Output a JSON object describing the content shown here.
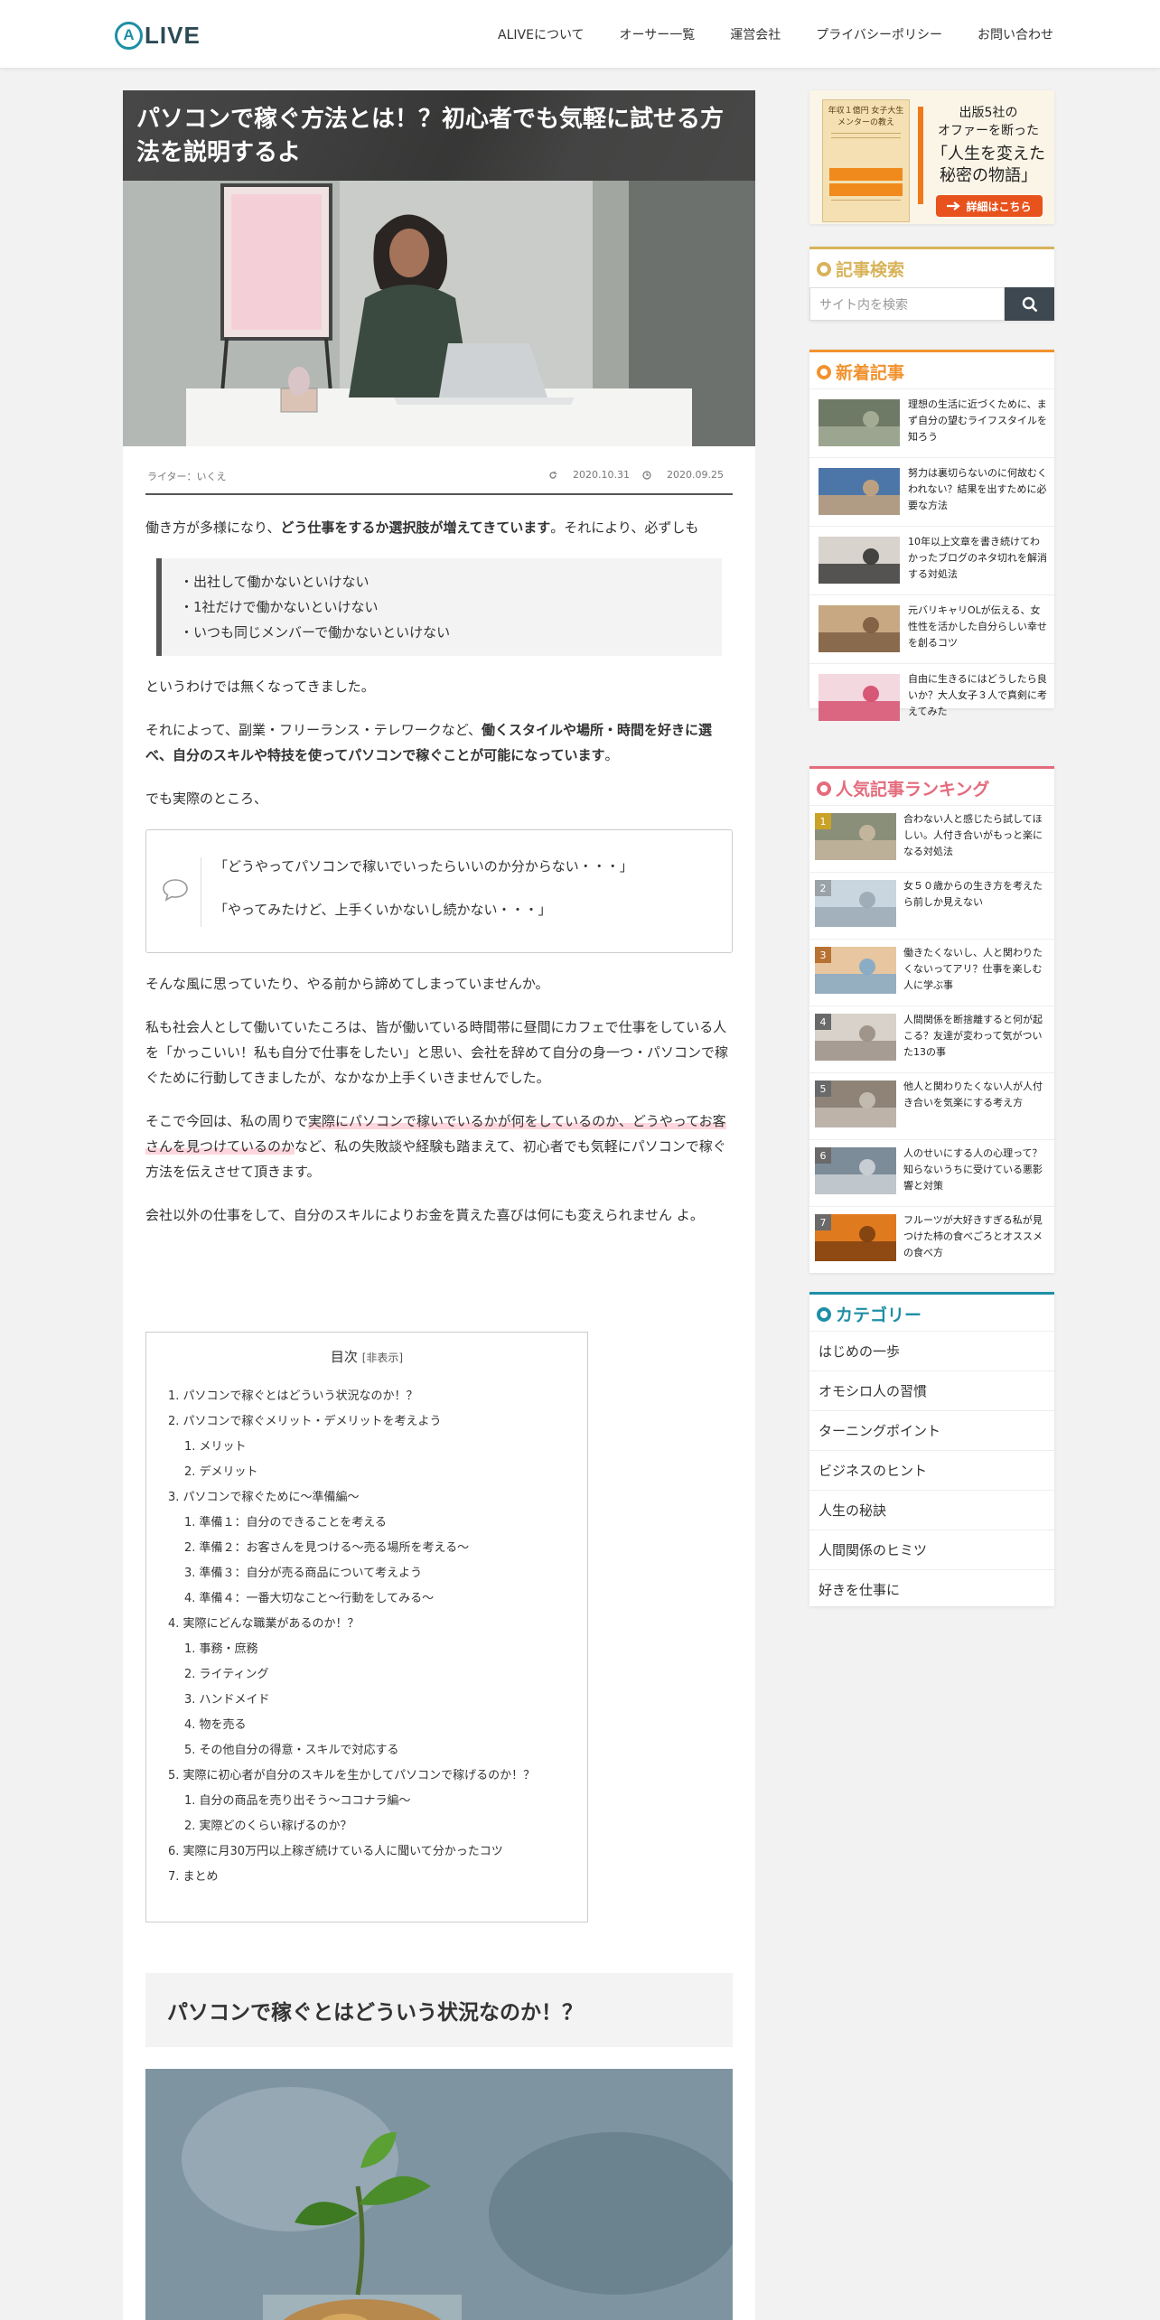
{
  "site": {
    "logo_letter": "A",
    "logo_text": "LIVE",
    "nav": [
      "ALIVEについて",
      "オーサー一覧",
      "運営会社",
      "プライバシーポリシー",
      "お問い合わせ"
    ]
  },
  "article": {
    "title": "パソコンで稼ぐ方法とは！？初心者でも気軽に試せる方法を説明するよ",
    "writer": "ライター：いくえ",
    "updated": "2020.10.31",
    "published": "2020.09.25",
    "p1_a": "働き方が多様になり、",
    "p1_b": "どう仕事をするか選択肢が増えてきています",
    "p1_c": "。それにより、必ずしも",
    "quote_lines": [
      "・出社して働かないといけない",
      "・1社だけで働かないといけない",
      "・いつも同じメンバーで働かないといけない"
    ],
    "p2": "というわけでは無くなってきました。",
    "p3_a": "それによって、副業・フリーランス・テレワークなど、",
    "p3_b": "働くスタイルや場所・時間を好きに選べ、自分のスキルや特技を使ってパソコンで稼ぐことが可能になっています",
    "p3_c": "。",
    "p4": "でも実際のところ、",
    "balloon_lines": [
      "「どうやってパソコンで稼いでいったらいいのか分からない・・・」",
      "「やってみたけど、上手くいかないし続かない・・・」"
    ],
    "p5": "そんな風に思っていたり、やる前から諦めてしまっていませんか。",
    "p6": "私も社会人として働いていたころは、皆が働いている時間帯に昼間にカフェで仕事をしている人を「かっこいい！私も自分で仕事をしたい」と思い、会社を辞めて自分の身一つ・パソコンで稼ぐために行動してきましたが、なかなか上手くいきませんでした。",
    "p7_a": "そこで今回は、私の周りで",
    "p7_b": "実際にパソコンで稼いでいるかが何をしているのか、どうやってお客さんを見つけているのか",
    "p7_c": "など、私の失敗談や経験も踏まえて、初心者でも気軽にパソコンで稼ぐ方法を伝えさせて頂きます。",
    "p8": "会社以外の仕事をして、自分のスキルによりお金を貰えた喜びは何にも変えられません よ。",
    "h2": "パソコンで稼ぐとはどういう状況なのか！？"
  },
  "toc": {
    "title": "目次",
    "toggle": "[非表示]",
    "items": [
      {
        "t": "1. パソコンで稼ぐとはどういう状況なのか！？",
        "sub": false
      },
      {
        "t": "2. パソコンで稼ぐメリット・デメリットを考えよう",
        "sub": false
      },
      {
        "t": "1. メリット",
        "sub": true
      },
      {
        "t": "2. デメリット",
        "sub": true
      },
      {
        "t": "3. パソコンで稼ぐために～準備編～",
        "sub": false
      },
      {
        "t": "1. 準備１：自分のできることを考える",
        "sub": true
      },
      {
        "t": "2. 準備２：お客さんを見つける～売る場所を考える～",
        "sub": true
      },
      {
        "t": "3. 準備３：自分が売る商品について考えよう",
        "sub": true
      },
      {
        "t": "4. 準備４：一番大切なこと～行動をしてみる～",
        "sub": true
      },
      {
        "t": "4. 実際にどんな職業があるのか！？",
        "sub": false
      },
      {
        "t": "1. 事務・庶務",
        "sub": true
      },
      {
        "t": "2. ライティング",
        "sub": true
      },
      {
        "t": "3. ハンドメイド",
        "sub": true
      },
      {
        "t": "4. 物を売る",
        "sub": true
      },
      {
        "t": "5. その他自分の得意・スキルで対応する",
        "sub": true
      },
      {
        "t": "5. 実際に初心者が自分のスキルを生かしてパソコンで稼げるのか！？",
        "sub": false
      },
      {
        "t": "1. 自分の商品を売り出そう～ココナラ編～",
        "sub": true
      },
      {
        "t": "2. 実際どのくらい稼げるのか？",
        "sub": true
      },
      {
        "t": "6. 実際に月30万円以上稼ぎ続けている人に聞いて分かったコツ",
        "sub": false
      },
      {
        "t": "7. まとめ",
        "sub": false
      }
    ]
  },
  "sidebar": {
    "banner": {
      "book_title": "年収１億円 女子大生メンターの教え",
      "line1": "出版5社の",
      "line2": "オファーを断った",
      "line3": "「人生を変えた",
      "line4": "秘密の物語」",
      "button": "詳細はこちら"
    },
    "search": {
      "heading": "記事検索",
      "placeholder": "サイト内を検索"
    },
    "new_posts": {
      "heading": "新着記事",
      "items": [
        "理想の生活に近づくために、まず自分の望むライフスタイルを知ろう",
        "努力は裏切らないのに何故むくわれない？結果を出すために必要な方法",
        "10年以上文章を書き続けてわかったブログのネタ切れを解消する対処法",
        "元バリキャリOLが伝える、女性性を活かした自分らしい幸せを創るコツ",
        "自由に生きるにはどうしたら良いか？大人女子３人で真剣に考えてみた"
      ]
    },
    "ranking": {
      "heading": "人気記事ランキング",
      "items": [
        {
          "n": "1",
          "t": "合わない人と感じたら試してほしい。人付き合いがもっと楽になる対処法"
        },
        {
          "n": "2",
          "t": "女５０歳からの生き方を考えたら前しか見えない"
        },
        {
          "n": "3",
          "t": "働きたくないし、人と関わりたくないってアリ？仕事を楽しむ人に学ぶ事"
        },
        {
          "n": "4",
          "t": "人間関係を断捨離すると何が起こる？友達が変わって気がついた13の事"
        },
        {
          "n": "5",
          "t": "他人と関わりたくない人が人付き合いを気楽にする考え方"
        },
        {
          "n": "6",
          "t": "人のせいにする人の心理って？知らないうちに受けている悪影響と対策"
        },
        {
          "n": "7",
          "t": "フルーツが大好きすぎる私が見つけた柿の食べごろとオススメの食べ方"
        }
      ]
    },
    "categories": {
      "heading": "カテゴリー",
      "items": [
        "はじめの一歩",
        "オモシロ人の習慣",
        "ターニングポイント",
        "ビジネスのヒント",
        "人生の秘訣",
        "人間関係のヒミツ",
        "好きを仕事に"
      ]
    }
  },
  "colors": {
    "accent": "#1e8fa6",
    "search": "#d8b35a",
    "new": "#f2922e",
    "ranking": "#e46b7c",
    "button": "#e8521c"
  }
}
